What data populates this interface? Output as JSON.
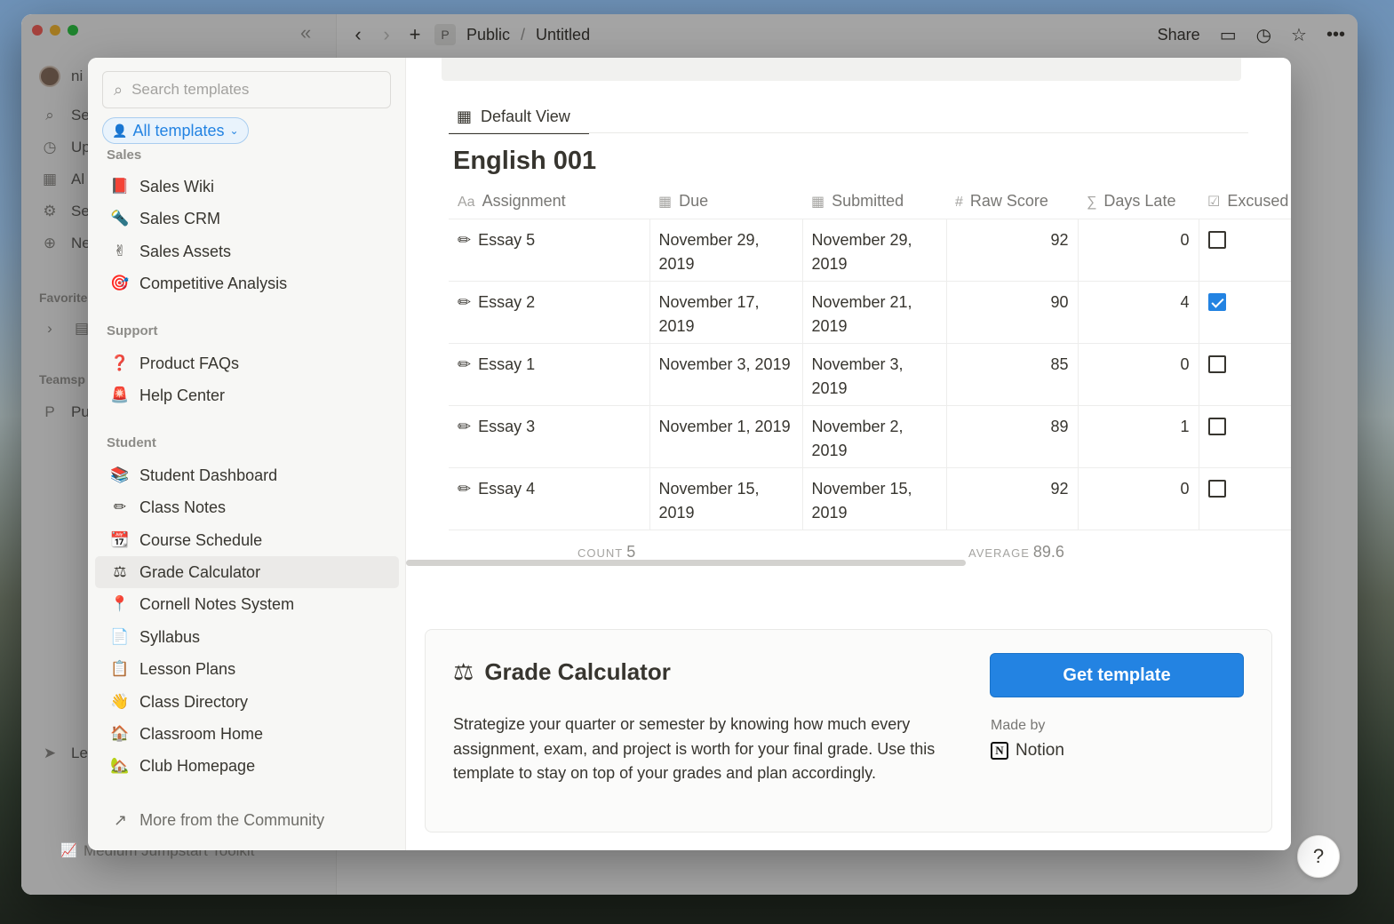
{
  "app_sidebar": {
    "user_name": "ni",
    "items": [
      {
        "icon": "search-icon",
        "label": "Se"
      },
      {
        "icon": "clock-icon",
        "label": "Up"
      },
      {
        "icon": "grid-icon",
        "label": "Al"
      },
      {
        "icon": "gear-icon",
        "label": "Se"
      },
      {
        "icon": "plus-circle-icon",
        "label": "Ne"
      }
    ],
    "favorites_label": "Favorite",
    "teamspaces_label": "Teamsp",
    "teamspace_p_label": "Pu",
    "bottom_item": "Le",
    "behind_row": "Medium Jumpstart Toolkit"
  },
  "topbar": {
    "space_badge": "P",
    "breadcrumb_parent": "Public",
    "breadcrumb_sep": "/",
    "breadcrumb_page": "Untitled",
    "share_label": "Share"
  },
  "template_sidebar": {
    "search_placeholder": "Search templates",
    "filter_label": "All templates",
    "sections": {
      "sales": "Sales",
      "support": "Support",
      "student": "Student"
    },
    "sales_items": [
      {
        "icon": "📕",
        "label": "Sales Wiki"
      },
      {
        "icon": "🔦",
        "label": "Sales CRM"
      },
      {
        "icon": "✌",
        "label": "Sales Assets"
      },
      {
        "icon": "🎯",
        "label": "Competitive Analysis"
      }
    ],
    "support_items": [
      {
        "icon": "❓",
        "label": "Product FAQs"
      },
      {
        "icon": "🚨",
        "label": "Help Center"
      }
    ],
    "student_items": [
      {
        "icon": "📚",
        "label": "Student Dashboard"
      },
      {
        "icon": "✏",
        "label": "Class Notes"
      },
      {
        "icon": "📆",
        "label": "Course Schedule"
      },
      {
        "icon": "⚖",
        "label": "Grade Calculator"
      },
      {
        "icon": "📍",
        "label": "Cornell Notes System"
      },
      {
        "icon": "📄",
        "label": "Syllabus"
      },
      {
        "icon": "📋",
        "label": "Lesson Plans"
      },
      {
        "icon": "👋",
        "label": "Class Directory"
      },
      {
        "icon": "🏠",
        "label": "Classroom Home"
      },
      {
        "icon": "🏡",
        "label": "Club Homepage"
      }
    ],
    "community_label": "More from the Community"
  },
  "preview": {
    "view_tab": "Default View",
    "db_title": "English 001",
    "columns": [
      {
        "icon": "Aa",
        "label": "Assignment"
      },
      {
        "icon": "▦",
        "label": "Due"
      },
      {
        "icon": "▦",
        "label": "Submitted"
      },
      {
        "icon": "#",
        "label": "Raw Score"
      },
      {
        "icon": "∑",
        "label": "Days Late"
      },
      {
        "icon": "☑",
        "label": "Excused"
      }
    ],
    "rows": [
      {
        "assignment": "Essay 5",
        "due": "November 29, 2019",
        "submitted": "November 29, 2019",
        "raw": "92",
        "late": "0",
        "excused": false
      },
      {
        "assignment": "Essay 2",
        "due": "November 17, 2019",
        "submitted": "November 21, 2019",
        "raw": "90",
        "late": "4",
        "excused": true
      },
      {
        "assignment": "Essay 1",
        "due": "November 3, 2019",
        "submitted": "November 3, 2019",
        "raw": "85",
        "late": "0",
        "excused": false
      },
      {
        "assignment": "Essay 3",
        "due": "November 1, 2019",
        "submitted": "November 2, 2019",
        "raw": "89",
        "late": "1",
        "excused": false
      },
      {
        "assignment": "Essay 4",
        "due": "November 15, 2019",
        "submitted": "November 15, 2019",
        "raw": "92",
        "late": "0",
        "excused": false
      }
    ],
    "count_label": "COUNT",
    "count_value": "5",
    "average_label": "AVERAGE",
    "average_value": "89.6"
  },
  "card": {
    "icon": "⚖",
    "title": "Grade Calculator",
    "description": "Strategize your quarter or semester by knowing how much every assignment, exam, and project is worth for your final grade. Use this template to stay on top of your grades and plan accordingly.",
    "button_label": "Get template",
    "made_by_label": "Made by",
    "maker_logo": "N",
    "maker_name": "Notion"
  },
  "help_label": "?"
}
